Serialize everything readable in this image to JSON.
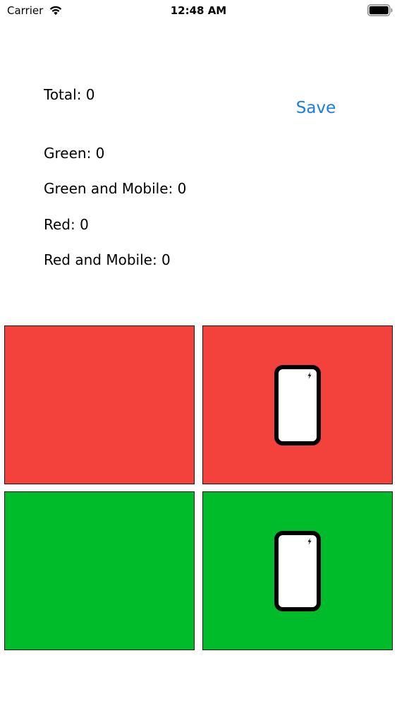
{
  "status_bar": {
    "carrier": "Carrier",
    "time": "12:48 AM",
    "wifi_icon": "wifi-icon",
    "battery_icon": "battery-full-icon"
  },
  "counters": {
    "total": "Total: 0",
    "green": "Green: 0",
    "green_mobile": "Green and Mobile: 0",
    "red": "Red: 0",
    "red_mobile": "Red and Mobile: 0"
  },
  "toolbar": {
    "save_label": "Save"
  },
  "tiles": [
    {
      "color": "#f2423b",
      "icon": ""
    },
    {
      "color": "#f2423b",
      "icon": "mobile-phone-icon"
    },
    {
      "color": "#00bb2a",
      "icon": ""
    },
    {
      "color": "#00bb2a",
      "icon": "mobile-phone-icon"
    }
  ],
  "colors": {
    "accent": "#1a7de0",
    "red_tile": "#f2423b",
    "green_tile": "#00bb2a"
  }
}
